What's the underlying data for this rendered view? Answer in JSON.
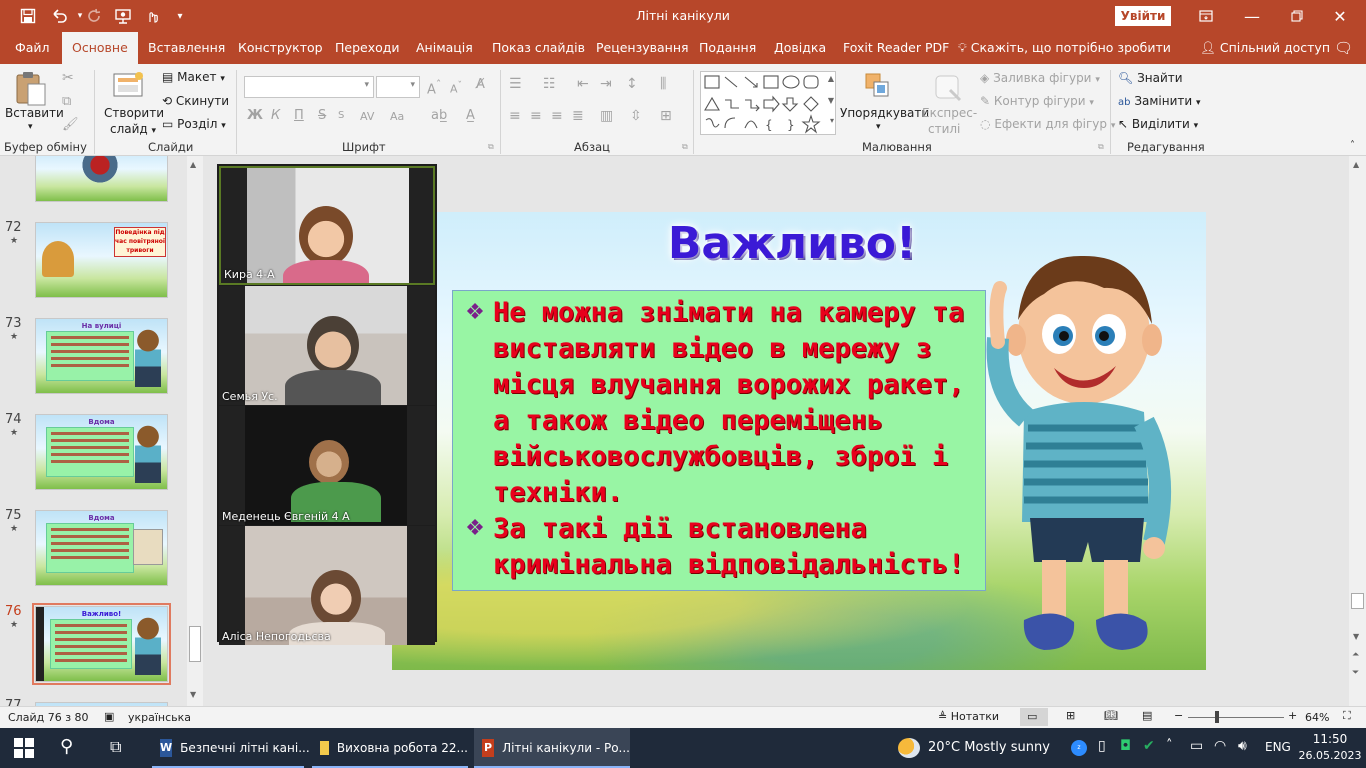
{
  "window": {
    "title": "Літні канікули",
    "signin": "Увійти"
  },
  "ribbon_tabs": [
    "Файл",
    "Основне",
    "Вставлення",
    "Конструктор",
    "Переходи",
    "Анімація",
    "Показ слайдів",
    "Рецензування",
    "Подання",
    "Довідка",
    "Foxit Reader PDF"
  ],
  "tell_me": "Скажіть, що потрібно зробити",
  "share": "Спільний доступ",
  "ribbon": {
    "clipboard": {
      "paste": "Вставити",
      "label": "Буфер обміну"
    },
    "slides": {
      "new_slide_1": "Створити",
      "new_slide_2": "слайд",
      "layout": "Макет",
      "reset": "Скинути",
      "section": "Розділ",
      "label": "Слайди"
    },
    "font": {
      "bold": "Ж",
      "italic": "К",
      "underline": "П",
      "strike": "S",
      "spacing": "AV",
      "case": "Aa",
      "label": "Шрифт"
    },
    "paragraph": {
      "label": "Абзац"
    },
    "drawing": {
      "arrange": "Упорядкувати",
      "quick_styles_1": "Експрес-",
      "quick_styles_2": "стилі",
      "fill": "Заливка фігури",
      "outline": "Контур фігури",
      "effects": "Ефекти для фігур",
      "label": "Малювання"
    },
    "editing": {
      "find": "Знайти",
      "replace": "Замінити",
      "select": "Виділити",
      "label": "Редагування"
    }
  },
  "thumbnails": [
    {
      "num": "72",
      "title": "Поведінка під час повітряної тривоги"
    },
    {
      "num": "73",
      "title": "На вулиці"
    },
    {
      "num": "74",
      "title": "Вдома"
    },
    {
      "num": "75",
      "title": "Вдома"
    },
    {
      "num": "76",
      "title": "Важливо!"
    },
    {
      "num": "77",
      "title": ""
    }
  ],
  "participants": [
    {
      "name": "Кира 4-А"
    },
    {
      "name": "Семья Ус."
    },
    {
      "name": "Меденець Євгеній 4 А"
    },
    {
      "name": "Аліса Непогодьєва"
    }
  ],
  "slide": {
    "title": "Важливо!",
    "bullet_1": "Не можна знімати на камеру та виставляти відео в мережу з місця влучання ворожих ракет, а також відео переміщень військовослужбовців, зброї і техніки.",
    "bullet_2": "За такі дії встановлена кримінальна відповідальність!"
  },
  "status": {
    "slide_counter": "Слайд 76 з 80",
    "language": "українська",
    "notes": "Нотатки",
    "zoom": "64%",
    "zoom_level": 64
  },
  "taskbar": {
    "items": [
      {
        "label": "Безпечні літні кані..."
      },
      {
        "label": "Виховна робота 22..."
      },
      {
        "label": "Літні канікули - Ро..."
      }
    ],
    "weather": "20°C  Mostly sunny",
    "lang": "ENG",
    "time": "11:50",
    "date": "26.05.2023"
  },
  "colors": {
    "accent": "#b7472a",
    "slide_title": "#3b1ad6",
    "slide_text": "#e8001c",
    "textbox_bg": "#98f5a4",
    "bullet": "#7a1f8a"
  }
}
